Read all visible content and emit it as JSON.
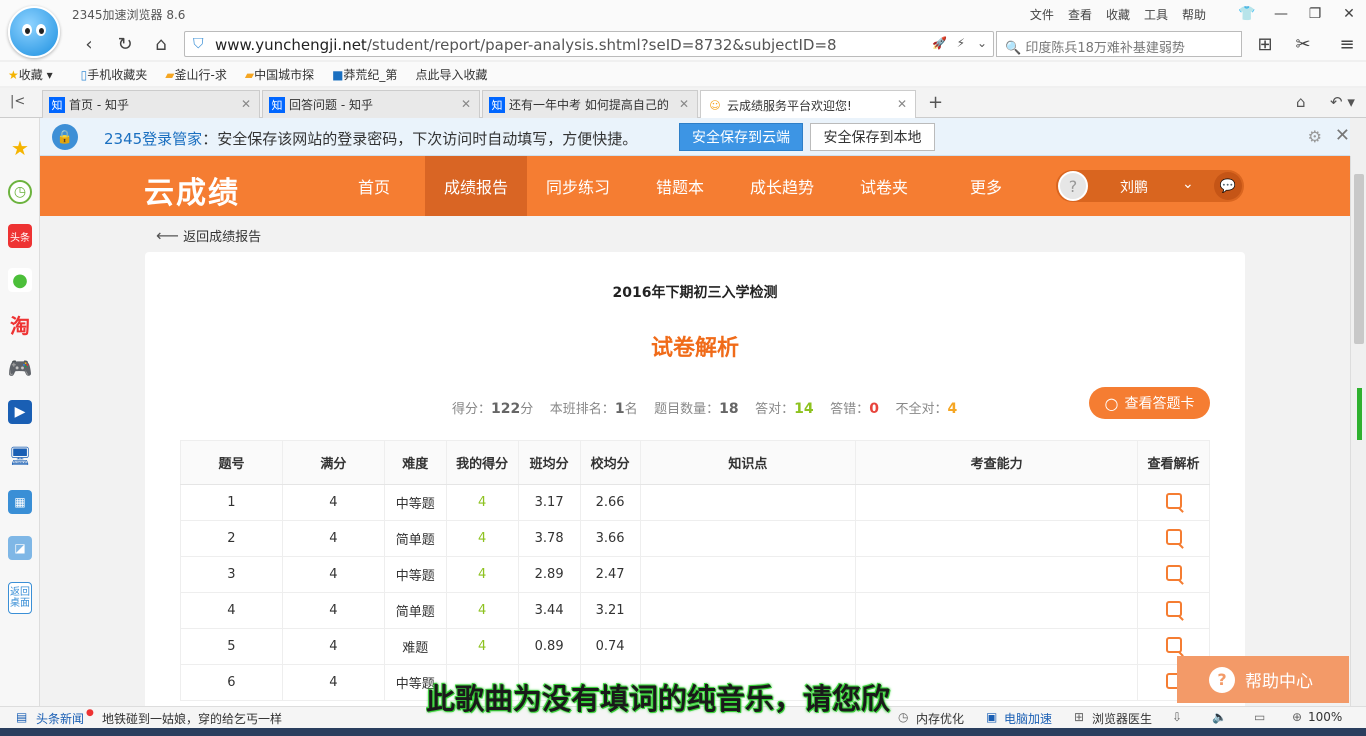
{
  "browser": {
    "app_title": "2345加速浏览器 8.6",
    "menu": [
      "文件",
      "查看",
      "收藏",
      "工具",
      "帮助"
    ],
    "url_domain": "www.yunchengji.net",
    "url_path": "/student/report/paper-analysis.shtml?seID=8732&subjectID=8",
    "search_text": "印度陈兵18万难补基建弱势",
    "bookmarks": [
      "收藏",
      "手机收藏夹",
      "釜山行-求",
      "中国城市探",
      "莽荒纪_第",
      "点此导入收藏"
    ],
    "tabs": [
      {
        "label": "首页 - 知乎",
        "favicon": "知"
      },
      {
        "label": "回答问题 - 知乎",
        "favicon": "知"
      },
      {
        "label": "还有一年中考 如何提高自己的",
        "favicon": "知"
      },
      {
        "label": "云成绩服务平台欢迎您!",
        "favicon": "☺"
      }
    ]
  },
  "password_bar": {
    "brand": "2345登录管家",
    "message": "：安全保存该网站的登录密码，下次访问时自动填写，方便快捷。",
    "save_cloud": "安全保存到云端",
    "save_local": "安全保存到本地"
  },
  "site": {
    "brand": "云成绩",
    "nav": [
      "首页",
      "成绩报告",
      "同步练习",
      "错题本",
      "成长趋势",
      "试卷夹",
      "更多"
    ],
    "active_nav": "成绩报告",
    "user_name": "刘鹏",
    "back_link": "返回成绩报告"
  },
  "report": {
    "exam_title": "2016年下期初三入学检测",
    "heading": "试卷解析",
    "stats": {
      "score_label": "得分：",
      "score": "122",
      "score_unit": "分",
      "rank_label": "本班排名：",
      "rank": "1",
      "rank_unit": "名",
      "count_label": "题目数量：",
      "count": "18",
      "correct_label": "答对：",
      "correct": "14",
      "wrong_label": "答错：",
      "wrong": "0",
      "partial_label": "不全对：",
      "partial": "4"
    },
    "answer_card_button": "查看答题卡",
    "columns": [
      "题号",
      "满分",
      "难度",
      "我的得分",
      "班均分",
      "校均分",
      "知识点",
      "考查能力",
      "查看解析"
    ],
    "rows": [
      {
        "no": "1",
        "full": "4",
        "difficulty": "中等题",
        "mine": "4",
        "class_avg": "3.17",
        "school_avg": "2.66",
        "knowledge": "",
        "ability": ""
      },
      {
        "no": "2",
        "full": "4",
        "difficulty": "简单题",
        "mine": "4",
        "class_avg": "3.78",
        "school_avg": "3.66",
        "knowledge": "",
        "ability": ""
      },
      {
        "no": "3",
        "full": "4",
        "difficulty": "中等题",
        "mine": "4",
        "class_avg": "2.89",
        "school_avg": "2.47",
        "knowledge": "",
        "ability": ""
      },
      {
        "no": "4",
        "full": "4",
        "difficulty": "简单题",
        "mine": "4",
        "class_avg": "3.44",
        "school_avg": "3.21",
        "knowledge": "",
        "ability": ""
      },
      {
        "no": "5",
        "full": "4",
        "difficulty": "难题",
        "mine": "4",
        "class_avg": "0.89",
        "school_avg": "0.74",
        "knowledge": "",
        "ability": ""
      },
      {
        "no": "6",
        "full": "4",
        "difficulty": "中等题",
        "mine": "",
        "class_avg": "",
        "school_avg": "",
        "knowledge": "",
        "ability": ""
      }
    ]
  },
  "help_center": "帮助中心",
  "overlay_subtitle": "此歌曲为没有填词的纯音乐，请您欣",
  "statusbar": {
    "news_label": "头条新闻",
    "news_text": "地铁碰到一姑娘，穿的给乞丐一样",
    "mem": "内存优化",
    "accel": "电脑加速",
    "doctor": "浏览器医生",
    "zoom": "100%"
  },
  "colors": {
    "brand_orange": "#f57d32",
    "score_green": "#8dc21f",
    "wrong_red": "#e7443c",
    "partial_orange": "#f5a623"
  }
}
